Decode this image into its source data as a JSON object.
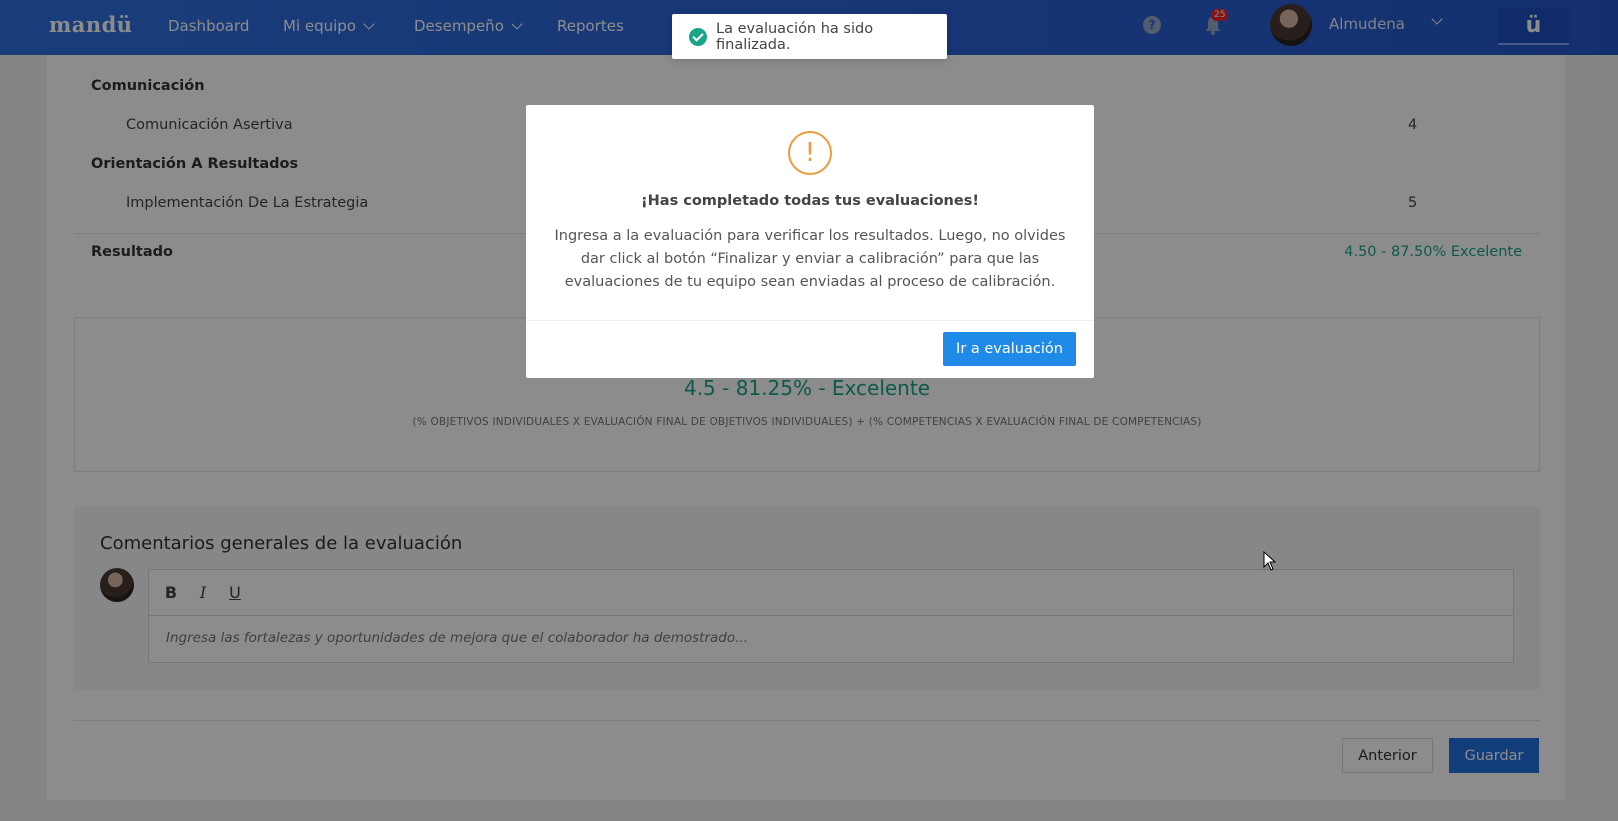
{
  "nav": {
    "logo": "mandü",
    "items": [
      {
        "label": "Dashboard"
      },
      {
        "label": "Mi equipo"
      },
      {
        "label": "Desempeño"
      },
      {
        "label": "Reportes"
      }
    ],
    "notification_count": "25",
    "user_name": "Almudena",
    "brand_button": "ü"
  },
  "competencies": [
    {
      "category": "Comunicación",
      "name": "Comunicación Asertiva",
      "score": "4"
    },
    {
      "category": "Orientación A Resultados",
      "name": "Implementación De La Estrategia",
      "score": "5"
    }
  ],
  "result": {
    "label": "Resultado",
    "value": "4.50 - 87.50% Excelente"
  },
  "final": {
    "score": "4.5 - 81.25% - Excelente",
    "formula": "(% OBJETIVOS INDIVIDUALES X EVALUACIÓN FINAL DE OBJETIVOS INDIVIDUALES) + (% COMPETENCIAS X EVALUACIÓN FINAL DE COMPETENCIAS)"
  },
  "comments": {
    "title": "Comentarios generales de la evaluación",
    "placeholder": "Ingresa las fortalezas y oportunidades de mejora que el colaborador ha demostrado...",
    "toolbar": {
      "bold": "B",
      "italic": "I",
      "underline": "U"
    }
  },
  "footer": {
    "prev_label": "Anterior",
    "save_label": "Guardar"
  },
  "modal": {
    "icon": "!",
    "title": "¡Has completado todas tus evaluaciones!",
    "body": "Ingresa a la evaluación para verificar los resultados. Luego, no olvides dar click al botón “Finalizar y enviar a calibración” para que las evaluaciones de tu equipo sean enviadas al proceso de calibración.",
    "button_label": "Ir a evaluación"
  },
  "toast": {
    "message": "La evaluación ha sido finalizada."
  },
  "colors": {
    "accent": "#1f6fe0",
    "success": "#18a58a",
    "warning": "#f09a3e"
  }
}
